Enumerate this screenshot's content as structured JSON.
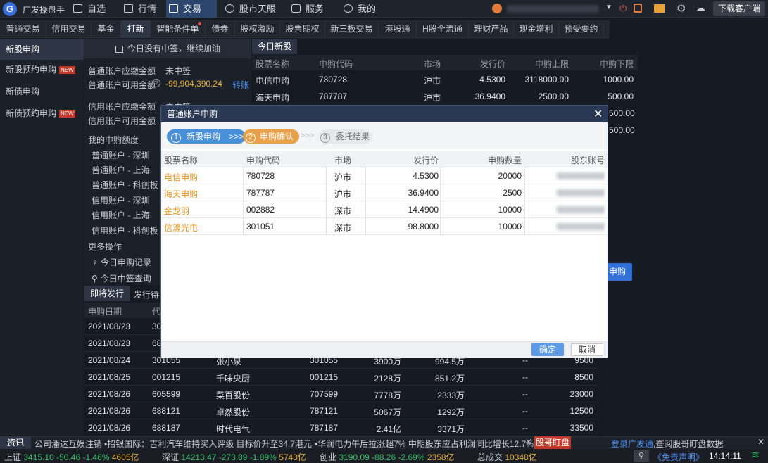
{
  "app": {
    "name": "广发操盘手",
    "download": "下载客户端",
    "user_masked": "●●●●●●●"
  },
  "topnav": [
    {
      "label": "自选"
    },
    {
      "label": "行情"
    },
    {
      "label": "交易"
    },
    {
      "label": "股市天眼"
    },
    {
      "label": "服务"
    },
    {
      "label": "我的"
    }
  ],
  "nav2": [
    "普通交易",
    "信用交易",
    "基金",
    "打新",
    "智能条件单",
    "债券",
    "股权激励",
    "股票期权",
    "新三板交易",
    "港股通",
    "H股全流通",
    "理财产品",
    "现金增利",
    "预受要约"
  ],
  "sidebar": [
    "新股申购",
    "新股预约申购",
    "新债申购",
    "新债预约申购"
  ],
  "new_badge": "NEW",
  "mid": {
    "banner": "今日没有中签，继续加油",
    "r1_label": "普通账户应缴金额",
    "r1_val": "未中签",
    "r2_label": "普通账户可用金额",
    "r2_val": "-99,904,390.24",
    "r2_link": "转账",
    "r3_label": "信用账户应缴金额",
    "r3_val": "未中签",
    "r4_label": "信用账户可用金额",
    "quota_title": "我的申购额度",
    "quota": [
      "普通账户 - 深圳",
      "普通账户 - 上海",
      "普通账户 - 科创板",
      "信用账户 - 深圳",
      "信用账户 - 上海",
      "信用账户 - 科创板"
    ],
    "more": "更多操作",
    "op1": "今日申购记录",
    "op2": "今日中签查询"
  },
  "today": {
    "tab": "今日新股",
    "headers": [
      "股票名称",
      "申购代码",
      "市场",
      "发行价",
      "申购上限",
      "申购下限"
    ],
    "rows": [
      [
        "电信申购",
        "780728",
        "沪市",
        "4.5300",
        "3118000.00",
        "1000.00"
      ],
      [
        "海天申购",
        "787787",
        "沪市",
        "36.9400",
        "2500.00",
        "500.00"
      ]
    ],
    "partial": [
      "500.00",
      "500.00"
    ],
    "apply_btn": "申购"
  },
  "bottom": {
    "tabs": [
      "即将发行",
      "发行待"
    ],
    "h1": "申购日期",
    "h2": "代",
    "rows": [
      [
        "2021/08/23",
        "30",
        "",
        "",
        "",
        "",
        "",
        ""
      ],
      [
        "2021/08/23",
        "68",
        "",
        "",
        "",
        "",
        "",
        ""
      ],
      [
        "2021/08/24",
        "301055",
        "张小泉",
        "301055",
        "3900万",
        "994.5万",
        "--",
        "9500"
      ],
      [
        "2021/08/25",
        "001215",
        "千味央厨",
        "001215",
        "2128万",
        "851.2万",
        "--",
        "8500"
      ],
      [
        "2021/08/26",
        "605599",
        "菜百股份",
        "707599",
        "7778万",
        "2333万",
        "--",
        "23000"
      ],
      [
        "2021/08/26",
        "688121",
        "卓然股份",
        "787121",
        "5067万",
        "1292万",
        "--",
        "12500"
      ],
      [
        "2021/08/26",
        "688187",
        "时代电气",
        "787187",
        "2.41亿",
        "3371万",
        "--",
        "33500"
      ]
    ]
  },
  "dialog": {
    "title": "普通账户申购",
    "steps": [
      "新股申购",
      "申购确认",
      "委托结果"
    ],
    "step_nums": [
      "1",
      "2",
      "3"
    ],
    "arrows": ">>>",
    "headers": [
      "股票名称",
      "申购代码",
      "市场",
      "发行价",
      "申购数量",
      "股东账号"
    ],
    "rows": [
      [
        "电信申购",
        "780728",
        "沪市",
        "4.5300",
        "20000"
      ],
      [
        "海天申购",
        "787787",
        "沪市",
        "36.9400",
        "2500"
      ],
      [
        "金龙羽",
        "002882",
        "深市",
        "14.4900",
        "10000"
      ],
      [
        "信濠光电",
        "301051",
        "深市",
        "98.8000",
        "10000"
      ]
    ],
    "ok": "确定",
    "cancel": "取消"
  },
  "news": {
    "label": "资讯",
    "items": [
      "公司潘达互娱注销",
      "•招银国际：吉利汽车维持买入评级 目标价升至34.7港元",
      "•华润电力午后拉涨超7% 中期股东应占利润同比增长12.7%"
    ],
    "badge": "股哥盯盘",
    "login": "登录广发通",
    "login_rest": ",查阅股哥盯盘数据"
  },
  "status": {
    "sh": "上证",
    "sh_v": "3415.10",
    "sh_c": "-50.46",
    "sh_p": "-1.46%",
    "sh_a": "4605亿",
    "sz": "深证",
    "sz_v": "14213.47",
    "sz_c": "-273.89",
    "sz_p": "-1.89%",
    "sz_a": "5743亿",
    "cy": "创业",
    "cy_v": "3190.09",
    "cy_c": "-88.26",
    "cy_p": "-2.69%",
    "cy_a": "2358亿",
    "tot": "总成交",
    "tot_v": "10348亿",
    "disclaimer": "《免责声明》",
    "time": "14:14:11"
  }
}
